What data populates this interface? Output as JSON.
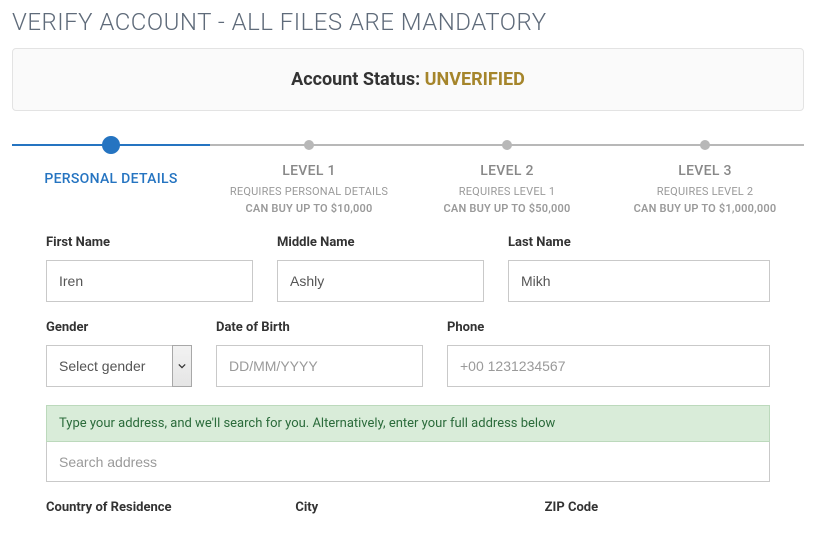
{
  "page_title": "VERIFY ACCOUNT - ALL FILES ARE MANDATORY",
  "status": {
    "label": "Account Status: ",
    "value": "UNVERIFIED"
  },
  "steps": [
    {
      "label": "PERSONAL DETAILS",
      "sub1": "",
      "sub2": ""
    },
    {
      "label": "LEVEL 1",
      "sub1": "REQUIRES PERSONAL DETAILS",
      "sub2": "CAN BUY UP TO $10,000"
    },
    {
      "label": "LEVEL 2",
      "sub1": "REQUIRES LEVEL 1",
      "sub2": "CAN BUY UP TO $50,000"
    },
    {
      "label": "LEVEL 3",
      "sub1": "REQUIRES LEVEL 2",
      "sub2": "CAN BUY UP TO $1,000,000"
    }
  ],
  "form": {
    "first_name": {
      "label": "First Name",
      "value": "Iren"
    },
    "middle_name": {
      "label": "Middle Name",
      "value": "Ashly"
    },
    "last_name": {
      "label": "Last Name",
      "value": "Mikh"
    },
    "gender": {
      "label": "Gender",
      "selected": "Select gender"
    },
    "dob": {
      "label": "Date of Birth",
      "placeholder": "DD/MM/YYYY"
    },
    "phone": {
      "label": "Phone",
      "placeholder": "+00 1231234567"
    },
    "address_hint": "Type your address, and we'll search for you. Alternatively, enter your full address below",
    "search_placeholder": "Search address",
    "country": {
      "label": "Country of Residence"
    },
    "city": {
      "label": "City"
    },
    "zip": {
      "label": "ZIP Code"
    }
  }
}
